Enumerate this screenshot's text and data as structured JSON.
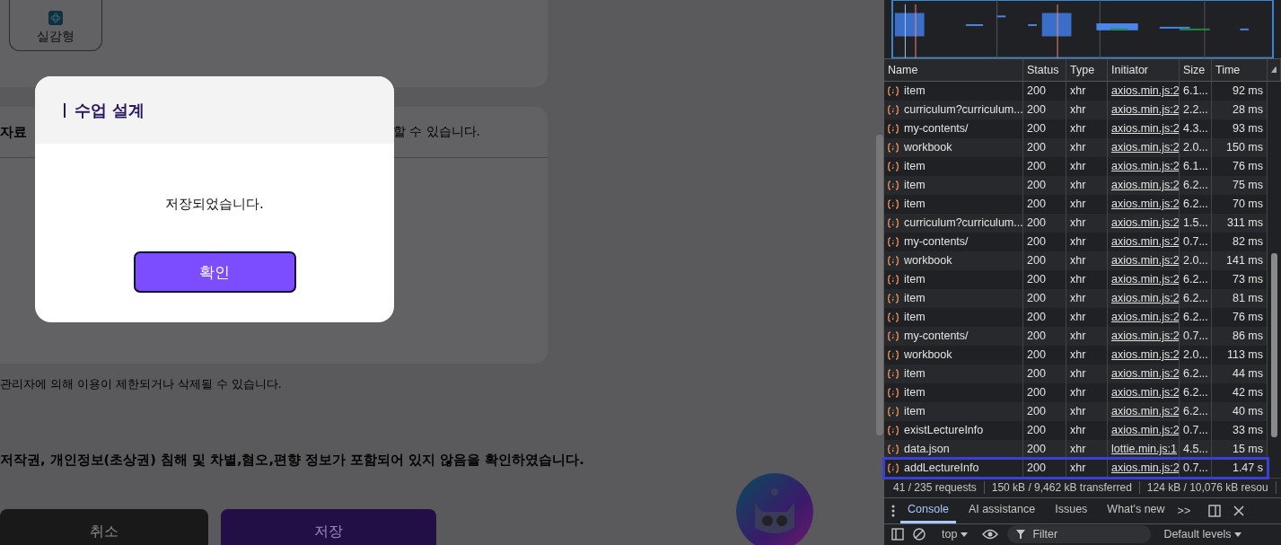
{
  "page": {
    "tile_label": "실감형",
    "section_label": "자료",
    "section_hint": "할 수 있습니다.",
    "notice": "관리자에 의해 이용이 제한되거나 삭제될 수 있습니다.",
    "confirm_statement": "저작권, 개인정보(초상권) 침해 및 차별,혐오,편향 정보가 포함되어 있지 않음을 확인하였습니다.",
    "buttons": [
      {
        "label": "취소",
        "kind": "cancel"
      },
      {
        "label": "저장",
        "kind": "save"
      }
    ]
  },
  "dialog": {
    "title": "수업 설계",
    "message": "저장되었습니다.",
    "button": "확인"
  },
  "devtools": {
    "columns": [
      "Name",
      "Status",
      "Type",
      "Initiator",
      "Size",
      "Time"
    ],
    "rows": [
      {
        "name": "item",
        "status": "200",
        "type": "xhr",
        "initiator": "axios.min.js:2",
        "size": "6.1...",
        "time": "92 ms",
        "highlighted": false
      },
      {
        "name": "curriculum?curriculum...",
        "status": "200",
        "type": "xhr",
        "initiator": "axios.min.js:2",
        "size": "2.2...",
        "time": "28 ms",
        "highlighted": false
      },
      {
        "name": "my-contents/",
        "status": "200",
        "type": "xhr",
        "initiator": "axios.min.js:2",
        "size": "4.3...",
        "time": "93 ms",
        "highlighted": false
      },
      {
        "name": "workbook",
        "status": "200",
        "type": "xhr",
        "initiator": "axios.min.js:2",
        "size": "2.0...",
        "time": "150 ms",
        "highlighted": false
      },
      {
        "name": "item",
        "status": "200",
        "type": "xhr",
        "initiator": "axios.min.js:2",
        "size": "6.1...",
        "time": "76 ms",
        "highlighted": false
      },
      {
        "name": "item",
        "status": "200",
        "type": "xhr",
        "initiator": "axios.min.js:2",
        "size": "6.2...",
        "time": "75 ms",
        "highlighted": false
      },
      {
        "name": "item",
        "status": "200",
        "type": "xhr",
        "initiator": "axios.min.js:2",
        "size": "6.2...",
        "time": "70 ms",
        "highlighted": false
      },
      {
        "name": "curriculum?curriculum...",
        "status": "200",
        "type": "xhr",
        "initiator": "axios.min.js:2",
        "size": "1.5...",
        "time": "311 ms",
        "highlighted": false
      },
      {
        "name": "my-contents/",
        "status": "200",
        "type": "xhr",
        "initiator": "axios.min.js:2",
        "size": "0.7...",
        "time": "82 ms",
        "highlighted": false
      },
      {
        "name": "workbook",
        "status": "200",
        "type": "xhr",
        "initiator": "axios.min.js:2",
        "size": "2.0...",
        "time": "141 ms",
        "highlighted": false
      },
      {
        "name": "item",
        "status": "200",
        "type": "xhr",
        "initiator": "axios.min.js:2",
        "size": "6.2...",
        "time": "73 ms",
        "highlighted": false
      },
      {
        "name": "item",
        "status": "200",
        "type": "xhr",
        "initiator": "axios.min.js:2",
        "size": "6.2...",
        "time": "81 ms",
        "highlighted": false
      },
      {
        "name": "item",
        "status": "200",
        "type": "xhr",
        "initiator": "axios.min.js:2",
        "size": "6.2...",
        "time": "76 ms",
        "highlighted": false
      },
      {
        "name": "my-contents/",
        "status": "200",
        "type": "xhr",
        "initiator": "axios.min.js:2",
        "size": "0.7...",
        "time": "86 ms",
        "highlighted": false
      },
      {
        "name": "workbook",
        "status": "200",
        "type": "xhr",
        "initiator": "axios.min.js:2",
        "size": "2.0...",
        "time": "113 ms",
        "highlighted": false
      },
      {
        "name": "item",
        "status": "200",
        "type": "xhr",
        "initiator": "axios.min.js:2",
        "size": "6.2...",
        "time": "44 ms",
        "highlighted": false
      },
      {
        "name": "item",
        "status": "200",
        "type": "xhr",
        "initiator": "axios.min.js:2",
        "size": "6.2...",
        "time": "42 ms",
        "highlighted": false
      },
      {
        "name": "item",
        "status": "200",
        "type": "xhr",
        "initiator": "axios.min.js:2",
        "size": "6.2...",
        "time": "40 ms",
        "highlighted": false
      },
      {
        "name": "existLectureInfo",
        "status": "200",
        "type": "xhr",
        "initiator": "axios.min.js:2",
        "size": "0.7...",
        "time": "33 ms",
        "highlighted": false
      },
      {
        "name": "data.json",
        "status": "200",
        "type": "xhr",
        "initiator": "lottie.min.js:1",
        "size": "4.5...",
        "time": "15 ms",
        "highlighted": false
      },
      {
        "name": "addLectureInfo",
        "status": "200",
        "type": "xhr",
        "initiator": "axios.min.js:2",
        "size": "0.7...",
        "time": "1.47 s",
        "highlighted": true
      }
    ],
    "summary": [
      "41 / 235 requests",
      "150 kB / 9,462 kB transferred",
      "124 kB / 10,076 kB resou"
    ],
    "drawer_tabs": [
      {
        "label": "Console",
        "selected": true
      },
      {
        "label": "AI assistance",
        "selected": false
      },
      {
        "label": "Issues",
        "selected": false
      },
      {
        "label": "What's new",
        "selected": false
      }
    ],
    "more_tabs": ">>",
    "context": "top",
    "filter_placeholder": "Filter",
    "levels": "Default levels"
  }
}
